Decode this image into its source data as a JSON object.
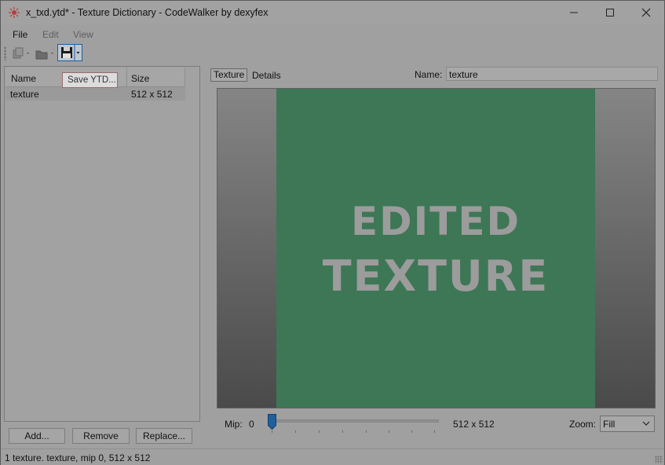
{
  "window": {
    "title": "x_txd.ytd* - Texture Dictionary - CodeWalker by dexyfex",
    "controls": [
      "minimize-icon",
      "maximize-icon",
      "close-icon"
    ]
  },
  "menu": {
    "file": "File",
    "edit": "Edit",
    "view": "View"
  },
  "toolbar": {
    "buttons": [
      "new-icon",
      "open-icon",
      "save-icon"
    ],
    "tooltip": "Save YTD..."
  },
  "texture_list": {
    "columns": [
      "Name",
      "Size"
    ],
    "rows": [
      {
        "name": "texture",
        "size": "512 x 512"
      }
    ]
  },
  "buttons": {
    "add": "Add...",
    "remove": "Remove",
    "replace": "Replace..."
  },
  "tabs": [
    "Texture",
    "Details"
  ],
  "name_field": {
    "label": "Name:",
    "value": "texture"
  },
  "preview": {
    "texture_text_line1": "EDITED",
    "texture_text_line2": "TEXTURE",
    "texture_color": "#3d7756"
  },
  "mip": {
    "label": "Mip:",
    "value": "0",
    "size": "512 x 512",
    "slider_position": 0
  },
  "zoom": {
    "label": "Zoom:",
    "value": "Fill"
  },
  "status": "1 texture. texture, mip 0, 512 x 512"
}
